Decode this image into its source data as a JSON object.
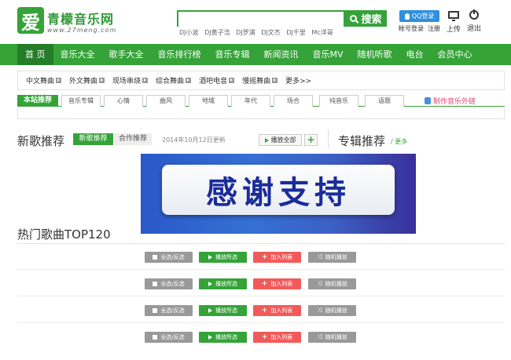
{
  "header": {
    "logo_mark": "爱",
    "logo_name": "青檬音乐网",
    "logo_url": "www.27meng.com",
    "search_placeholder": "",
    "search_label": "搜索",
    "hot_searches": [
      "DJ小波",
      "DJ黄子浩",
      "DJ罗浦",
      "DJ文杰",
      "DJ千里",
      "Mc洋哥"
    ],
    "qq_login": "QQ登录",
    "account_login": "帐号登录",
    "register": "注册",
    "upload": "上传",
    "logout": "退出"
  },
  "nav": {
    "items": [
      "首 页",
      "音乐大全",
      "歌手大全",
      "音乐排行榜",
      "音乐专辑",
      "新闻资讯",
      "音乐MV",
      "随机听歌",
      "电台",
      "会员中心"
    ]
  },
  "categories": [
    "中文舞曲",
    "外文舞曲",
    "现场串烧",
    "综合舞曲",
    "酒吧电音",
    "慢摇舞曲",
    "更多>>"
  ],
  "recommend": {
    "title": "本站推荐",
    "tabs": [
      "音乐专辑",
      "心情",
      "曲风",
      "地域",
      "年代",
      "场合",
      "纯音乐",
      "语题"
    ],
    "submit": "制作音乐外链"
  },
  "new_songs": {
    "title": "新歌推荐",
    "tab_new": "新歌推荐",
    "tab_collab": "合作推荐",
    "date": "2014年10月12日更新",
    "play_all": "播放全部",
    "add": "+"
  },
  "album": {
    "title": "专辑推荐",
    "more": "/ 更多"
  },
  "banner_text": "感谢支持",
  "hot": {
    "title": "热门歌曲TOP120",
    "controls": {
      "select": "全选/反选",
      "play": "播放所选",
      "add": "加入列表",
      "random": "随机播放"
    }
  },
  "colors": {
    "brand_green": "#35a338",
    "nav_active": "#257d28",
    "add_red": "#f25a5a",
    "qq_blue": "#2f8fdc"
  }
}
